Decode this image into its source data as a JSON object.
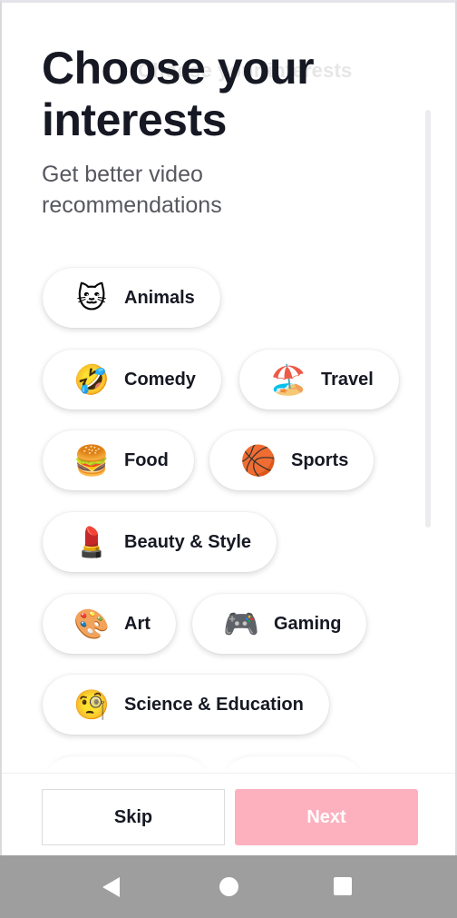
{
  "header": {
    "ghost_title": "Choose your interests",
    "title": "Choose your interests",
    "subtitle": "Get better video recommendations"
  },
  "interests": [
    {
      "label": "Animals",
      "emoji": "🐱",
      "icon": "cat-face-icon"
    },
    {
      "label": "Comedy",
      "emoji": "🤣",
      "icon": "laughing-face-icon"
    },
    {
      "label": "Travel",
      "emoji": "🏖️",
      "icon": "beach-umbrella-icon"
    },
    {
      "label": "Food",
      "emoji": "🍔",
      "icon": "hamburger-icon"
    },
    {
      "label": "Sports",
      "emoji": "🏀",
      "icon": "basketball-icon"
    },
    {
      "label": "Beauty & Style",
      "emoji": "💄",
      "icon": "lipstick-icon"
    },
    {
      "label": "Art",
      "emoji": "🎨",
      "icon": "palette-icon"
    },
    {
      "label": "Gaming",
      "emoji": "🎮",
      "icon": "game-controller-icon"
    },
    {
      "label": "Science & Education",
      "emoji": "🧐",
      "icon": "monocle-face-icon"
    },
    {
      "label": "",
      "emoji": "",
      "icon": "partially-hidden-icon"
    },
    {
      "label": "",
      "emoji": "",
      "icon": "partially-hidden-icon"
    }
  ],
  "footer": {
    "skip_label": "Skip",
    "next_label": "Next"
  },
  "colors": {
    "text_primary": "#161823",
    "text_secondary": "#57585f",
    "next_disabled": "#fdb1bf",
    "nav_bar": "#9e9e9e"
  },
  "system_nav": {
    "back_icon": "back-triangle-icon",
    "home_icon": "home-circle-icon",
    "recents_icon": "recents-square-icon"
  }
}
